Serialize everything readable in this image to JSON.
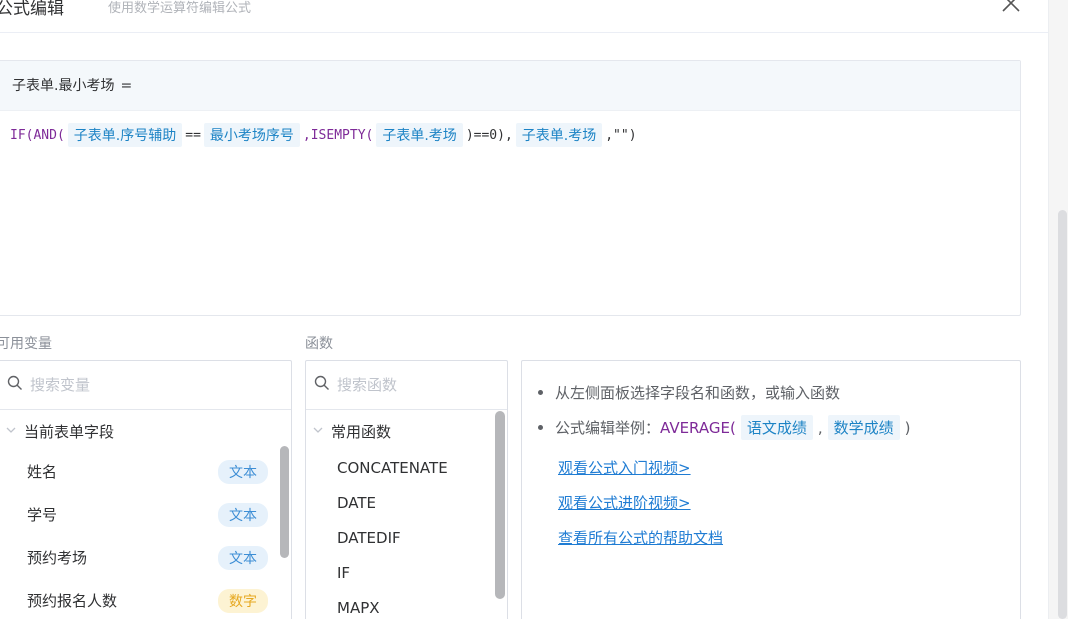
{
  "header": {
    "title": "公式编辑",
    "subtitle": "使用数学运算符编辑公式"
  },
  "editor": {
    "target_field": "子表单.最小考场",
    "equals": "=",
    "formula": [
      {
        "t": "fn",
        "v": "IF(AND("
      },
      {
        "t": "tok",
        "v": "子表单.序号辅助"
      },
      {
        "t": "op",
        "v": "=="
      },
      {
        "t": "tok",
        "v": "最小考场序号"
      },
      {
        "t": "fn",
        "v": ",ISEMPTY("
      },
      {
        "t": "tok",
        "v": "子表单.考场"
      },
      {
        "t": "op",
        "v": ")==0),"
      },
      {
        "t": "tok",
        "v": "子表单.考场"
      },
      {
        "t": "op",
        "v": ",\"\")"
      }
    ]
  },
  "variables": {
    "label": "可用变量",
    "search_placeholder": "搜索变量",
    "group": "当前表单字段",
    "items": [
      {
        "name": "姓名",
        "type": "文本",
        "kind": "text"
      },
      {
        "name": "学号",
        "type": "文本",
        "kind": "text"
      },
      {
        "name": "预约考场",
        "type": "文本",
        "kind": "text"
      },
      {
        "name": "预约报名人数",
        "type": "数字",
        "kind": "num"
      }
    ]
  },
  "functions": {
    "label": "函数",
    "search_placeholder": "搜索函数",
    "group": "常用函数",
    "items": [
      "CONCATENATE",
      "DATE",
      "DATEDIF",
      "IF",
      "MAPX"
    ]
  },
  "help": {
    "tip1": "从左侧面板选择字段名和函数，或输入函数",
    "tip2_prefix": "公式编辑举例：",
    "tip2_fn": "AVERAGE(",
    "tip2_arg1": "语文成绩",
    "tip2_sep": ",",
    "tip2_arg2": "数学成绩",
    "tip2_close": ")",
    "links": [
      "观看公式入门视频>",
      "观看公式进阶视频>",
      "查看所有公式的帮助文档"
    ]
  },
  "colors": {
    "function": "#7e2a98",
    "field_token_bg": "#eef5fb",
    "field_token_text": "#1c83c5",
    "link": "#1f7cd3"
  },
  "icons": {
    "close": "close-icon",
    "search": "search-icon",
    "collapse": "chevron-down-icon"
  }
}
